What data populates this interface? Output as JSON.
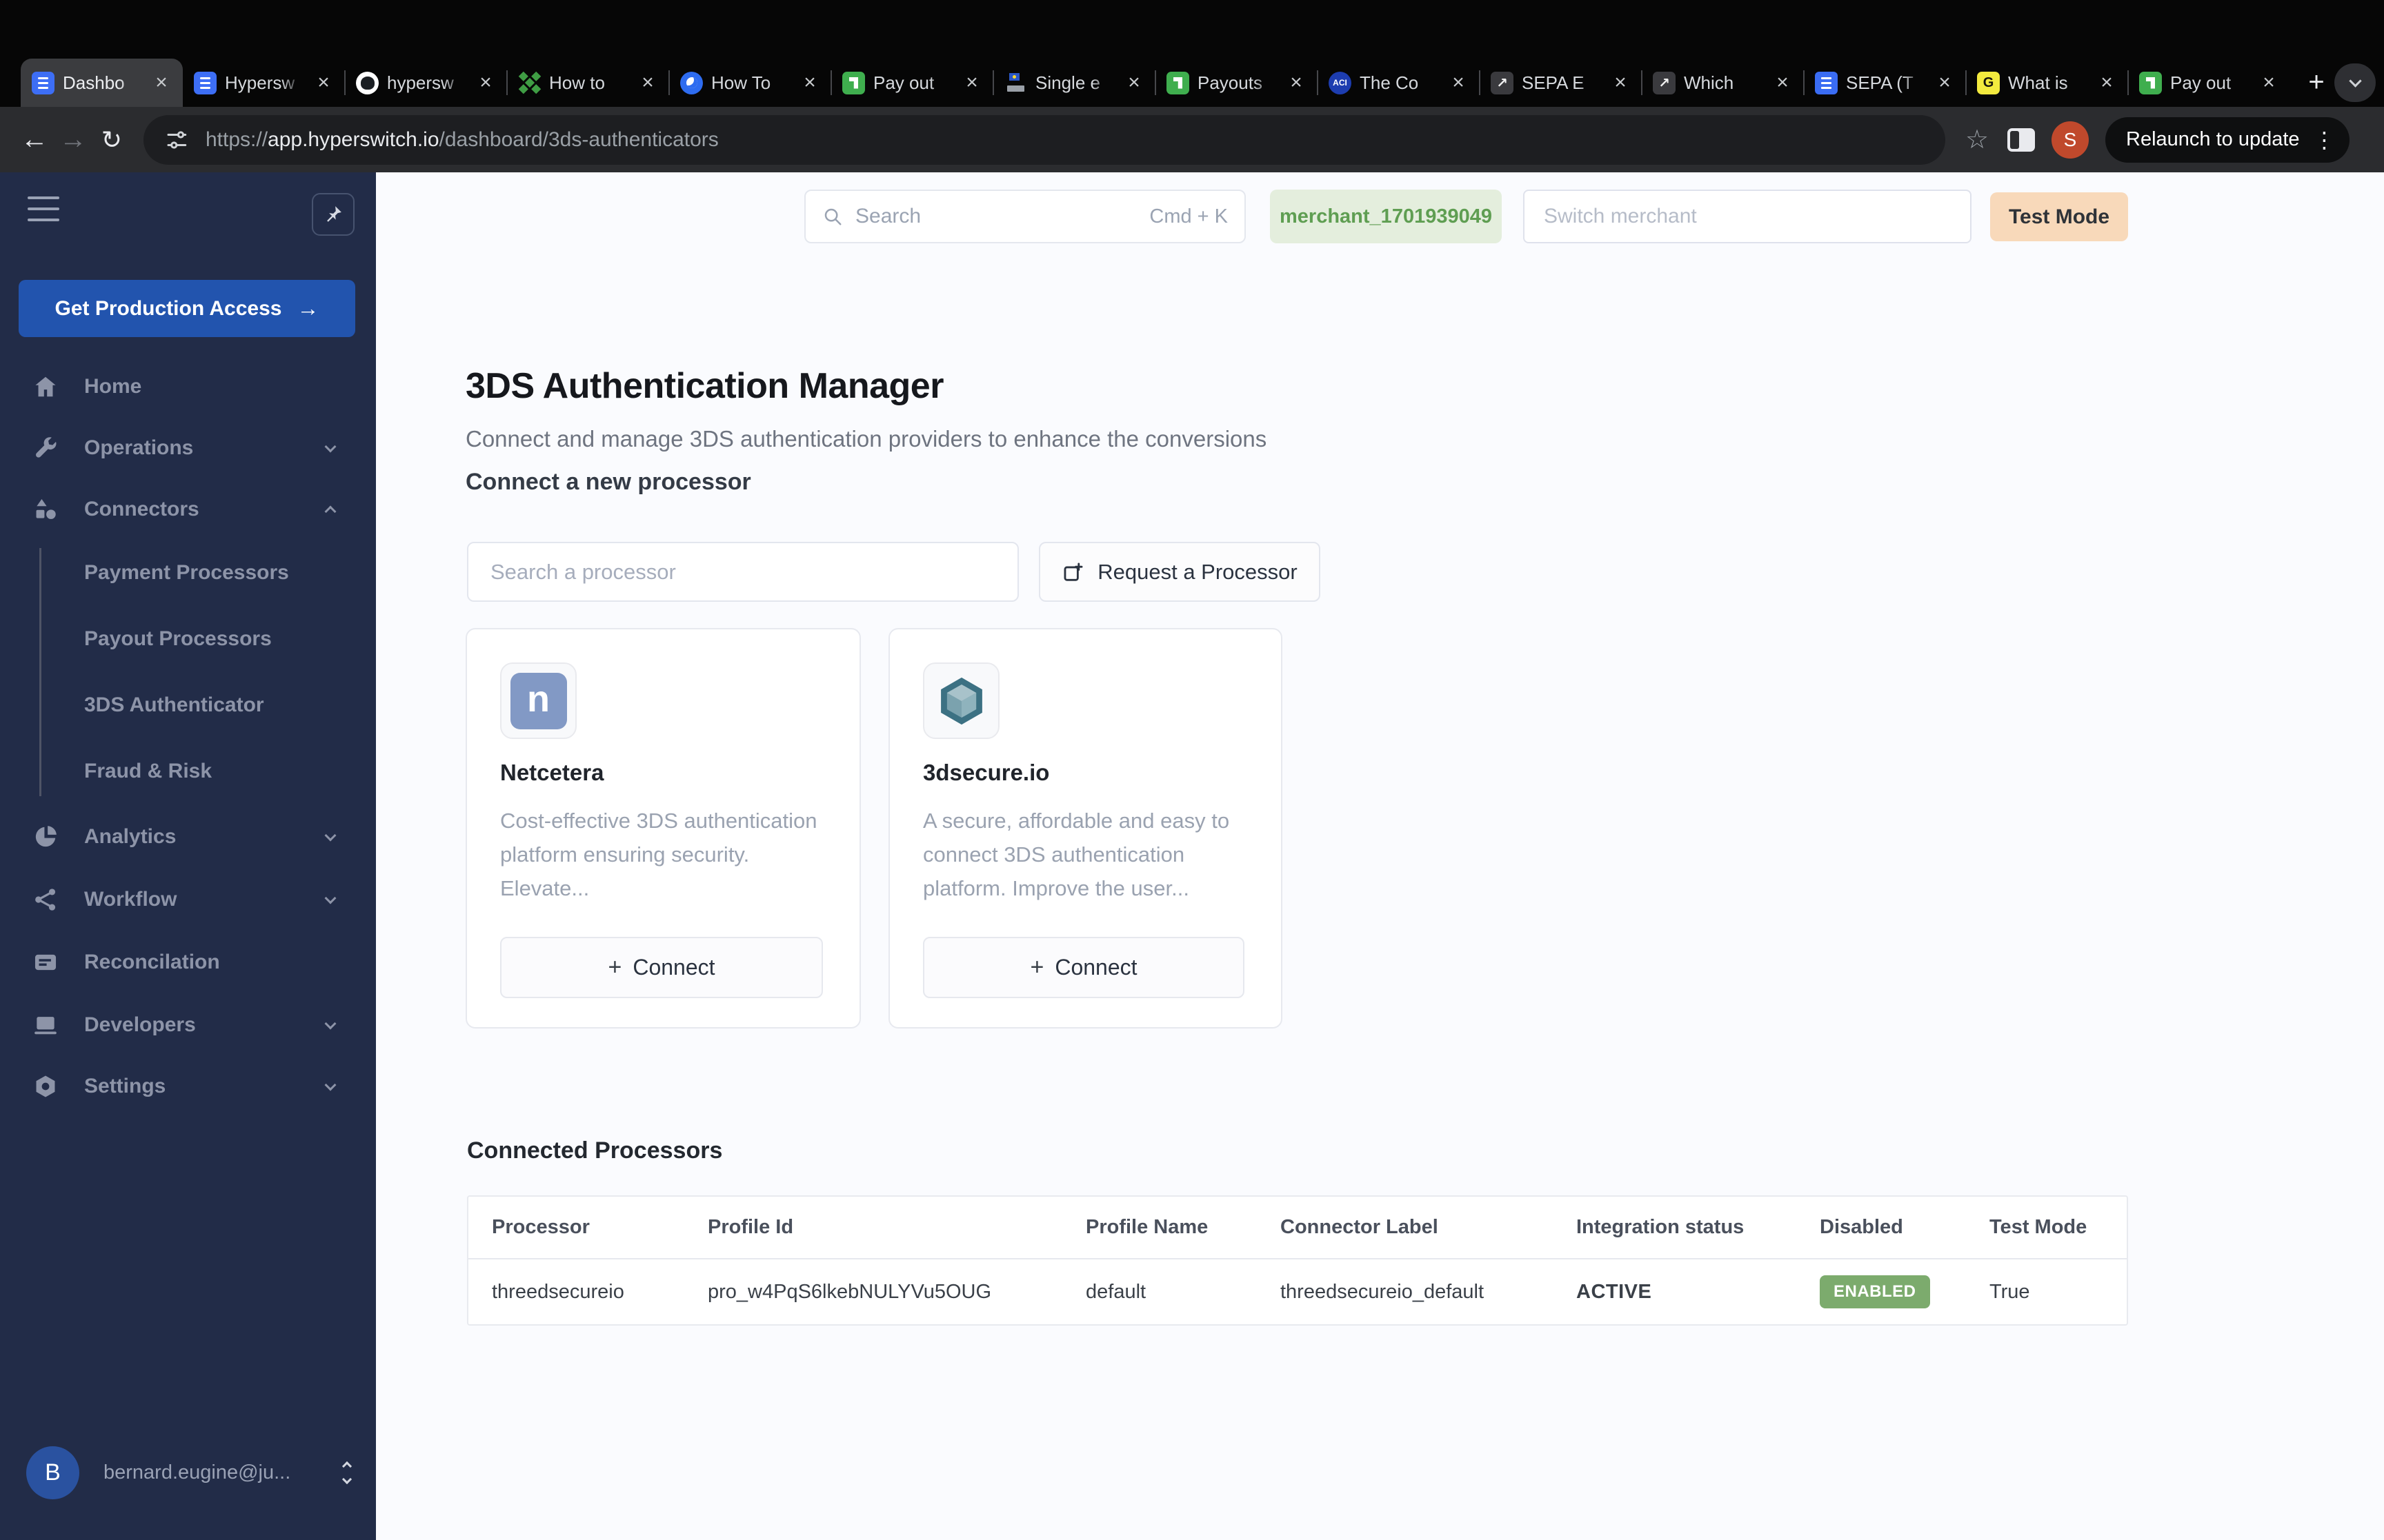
{
  "browser": {
    "tabs": [
      {
        "label": "Dashbo",
        "favicon": "hyperswitch-logo"
      },
      {
        "label": "Hypersw",
        "favicon": "hyperswitch-logo"
      },
      {
        "label": "hypersw",
        "favicon": "github-logo"
      },
      {
        "label": "How to",
        "favicon": "green-clover"
      },
      {
        "label": "How To",
        "favicon": "blue-circle"
      },
      {
        "label": "Pay out",
        "favicon": "green-square"
      },
      {
        "label": "Single e",
        "favicon": "eu-flag"
      },
      {
        "label": "Payouts",
        "favicon": "green-square"
      },
      {
        "label": "The Co",
        "favicon": "aci-worldwide",
        "favicon_text": "ACI"
      },
      {
        "label": "SEPA E",
        "favicon": "trend-chart"
      },
      {
        "label": "Which",
        "favicon": "trend-chart"
      },
      {
        "label": "SEPA (T",
        "favicon": "google-docs"
      },
      {
        "label": "What is",
        "favicon": "gocardless",
        "favicon_text": "G"
      },
      {
        "label": "Pay out",
        "favicon": "green-square"
      }
    ],
    "url": {
      "scheme": "https://",
      "host": "app.hyperswitch.io",
      "path": "/dashboard/3ds-authenticators"
    },
    "relaunch_label": "Relaunch to update",
    "profile_initial": "S"
  },
  "sidebar": {
    "cta_label": "Get Production Access",
    "items": [
      {
        "label": "Home"
      },
      {
        "label": "Operations"
      },
      {
        "label": "Connectors"
      },
      {
        "label": "Analytics"
      },
      {
        "label": "Workflow"
      },
      {
        "label": "Reconcilation"
      },
      {
        "label": "Developers"
      },
      {
        "label": "Settings"
      }
    ],
    "connector_subitems": [
      {
        "label": "Payment Processors"
      },
      {
        "label": "Payout Processors"
      },
      {
        "label": "3DS Authenticator"
      },
      {
        "label": "Fraud & Risk"
      }
    ],
    "user": {
      "initial": "B",
      "email": "bernard.eugine@ju..."
    }
  },
  "topbar": {
    "search_placeholder": "Search",
    "search_shortcut": "Cmd + K",
    "merchant_id": "merchant_1701939049",
    "switch_placeholder": "Switch merchant",
    "test_mode_label": "Test Mode"
  },
  "main": {
    "title": "3DS Authentication Manager",
    "subtitle": "Connect and manage 3DS authentication providers to enhance the conversions",
    "connect_section_title": "Connect a new processor",
    "processor_search_placeholder": "Search a processor",
    "request_button_label": "Request a Processor",
    "cards": [
      {
        "name": "Netcetera",
        "logo_letter": "n",
        "description": "Cost-effective 3DS authentication platform ensuring security. Elevate...",
        "connect_label": "Connect"
      },
      {
        "name": "3dsecure.io",
        "description": "A secure, affordable and easy to connect 3DS authentication platform. Improve the user...",
        "connect_label": "Connect"
      }
    ],
    "connected_section_title": "Connected Processors",
    "table": {
      "headers": [
        "Processor",
        "Profile Id",
        "Profile Name",
        "Connector Label",
        "Integration status",
        "Disabled",
        "Test Mode"
      ],
      "rows": [
        {
          "processor": "threedsecureio",
          "profile_id": "pro_w4PqS6lkebNULYVu5OUG",
          "profile_name": "default",
          "connector_label": "threedsecureio_default",
          "integration_status": "ACTIVE",
          "disabled": "ENABLED",
          "test_mode": "True"
        }
      ]
    },
    "colors": {
      "accent_blue": "#2254ae",
      "active_green": "#72b860",
      "enabled_badge_green": "#7cab6d",
      "test_mode_peach": "#f8d9ba",
      "merchant_badge_green": "#e4eedd",
      "sidebar_navy": "#222c48"
    }
  }
}
